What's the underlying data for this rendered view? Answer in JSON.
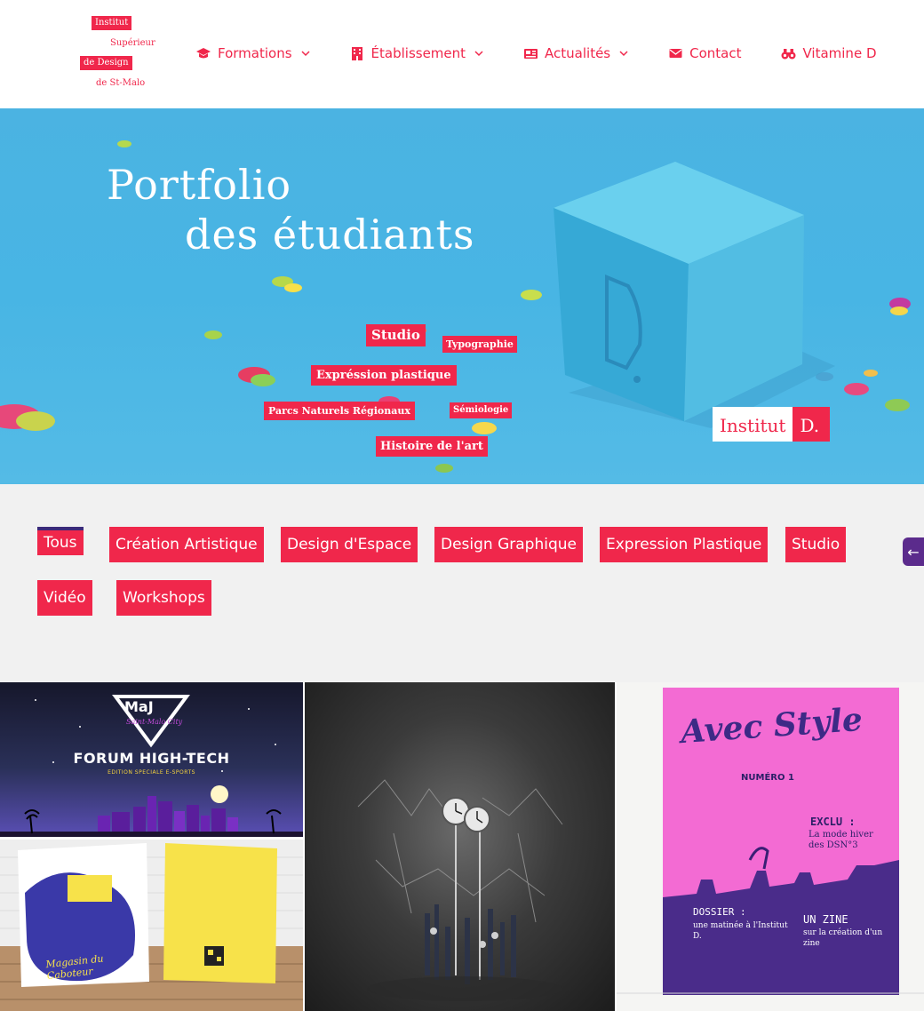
{
  "logo": {
    "line1": "Institut",
    "line2": "Supérieur",
    "line3": "de Design",
    "line4": "de St-Malo"
  },
  "nav": {
    "items": [
      {
        "label": "Formations",
        "icon": "graduation-cap-icon",
        "has_dropdown": true
      },
      {
        "label": "Établissement",
        "icon": "building-icon",
        "has_dropdown": true
      },
      {
        "label": "Actualités",
        "icon": "newspaper-icon",
        "has_dropdown": true
      },
      {
        "label": "Contact",
        "icon": "envelope-icon",
        "has_dropdown": false
      },
      {
        "label": "Vitamine D",
        "icon": "binoculars-icon",
        "has_dropdown": false
      }
    ]
  },
  "hero": {
    "title_line1": "Portfolio",
    "title_line2": "des étudiants",
    "tags": [
      "Studio",
      "Typographie",
      "Expréssion plastique",
      "Parcs Naturels Régionaux",
      "Sémiologie",
      "Histoire de l'art"
    ],
    "badge_left": "Institut",
    "badge_right": "D.",
    "cube_letter": "D."
  },
  "filters": {
    "items": [
      "Tous",
      "Création Artistique",
      "Design d'Espace",
      "Design Graphique",
      "Expression Plastique",
      "Studio",
      "Vidéo",
      "Workshops"
    ],
    "active": "Tous"
  },
  "side_tab": {
    "label": "←"
  },
  "portfolio": {
    "tile1": {
      "logo": "MaJ",
      "tagline": "Saint-Malo City",
      "title": "FORUM HIGH-TECH",
      "subtitle": "EDITION SPECIALE E-SPORTS"
    },
    "tile2": {
      "title": "Magasin du Caboteur"
    },
    "tile4": {
      "title": "Avec Style",
      "number": "NUMÉRO 1",
      "exclu": "EXCLU :",
      "exclu_text": "La mode hiver des DSN°3",
      "dossier": "DOSSIER :",
      "dossier_text": "une matinée à l'Institut D.",
      "zine": "UN ZINE",
      "zine_text": "sur la création d'un zine"
    }
  },
  "colors": {
    "accent": "#f0274b",
    "hero_bg": "#4bb3e2",
    "filter_bg": "#f1f1f1",
    "active_border": "#3b2a7a",
    "side_tab": "#5b2b8c"
  }
}
